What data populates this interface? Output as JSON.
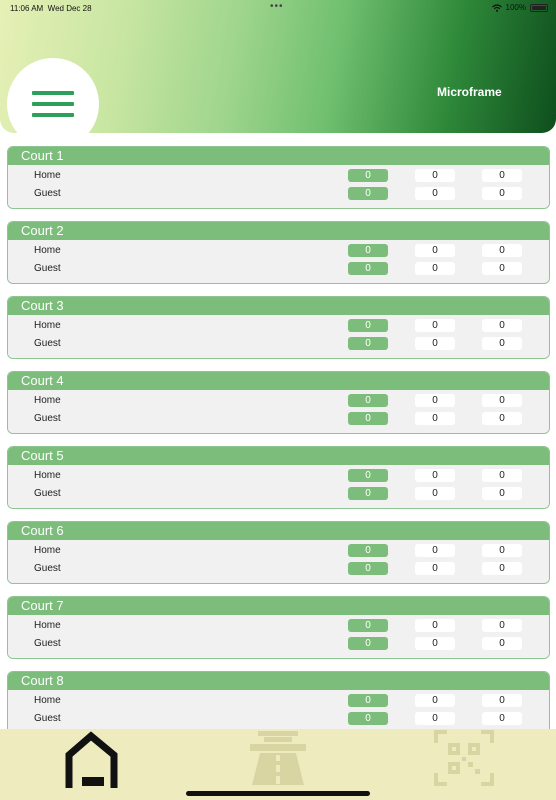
{
  "status": {
    "time": "11:06 AM",
    "date": "Wed Dec 28",
    "battery": "100%"
  },
  "header": {
    "title": "Microframe"
  },
  "courts": [
    {
      "name": "Court 1",
      "home_label": "Home",
      "guest_label": "Guest",
      "home": [
        "0",
        "0",
        "0"
      ],
      "guest": [
        "0",
        "0",
        "0"
      ]
    },
    {
      "name": "Court 2",
      "home_label": "Home",
      "guest_label": "Guest",
      "home": [
        "0",
        "0",
        "0"
      ],
      "guest": [
        "0",
        "0",
        "0"
      ]
    },
    {
      "name": "Court 3",
      "home_label": "Home",
      "guest_label": "Guest",
      "home": [
        "0",
        "0",
        "0"
      ],
      "guest": [
        "0",
        "0",
        "0"
      ]
    },
    {
      "name": "Court 4",
      "home_label": "Home",
      "guest_label": "Guest",
      "home": [
        "0",
        "0",
        "0"
      ],
      "guest": [
        "0",
        "0",
        "0"
      ]
    },
    {
      "name": "Court 5",
      "home_label": "Home",
      "guest_label": "Guest",
      "home": [
        "0",
        "0",
        "0"
      ],
      "guest": [
        "0",
        "0",
        "0"
      ]
    },
    {
      "name": "Court 6",
      "home_label": "Home",
      "guest_label": "Guest",
      "home": [
        "0",
        "0",
        "0"
      ],
      "guest": [
        "0",
        "0",
        "0"
      ]
    },
    {
      "name": "Court 7",
      "home_label": "Home",
      "guest_label": "Guest",
      "home": [
        "0",
        "0",
        "0"
      ],
      "guest": [
        "0",
        "0",
        "0"
      ]
    },
    {
      "name": "Court 8",
      "home_label": "Home",
      "guest_label": "Guest",
      "home": [
        "0",
        "0",
        "0"
      ],
      "guest": [
        "0",
        "0",
        "0"
      ]
    }
  ],
  "tabs": [
    {
      "icon": "home-icon",
      "active": true
    },
    {
      "icon": "road-icon",
      "active": false
    },
    {
      "icon": "qr-scan-icon",
      "active": false
    }
  ],
  "colors": {
    "accent": "#7dbd7b",
    "menu_icon": "#2e9f5c",
    "tab_bar": "#eeecbf",
    "header_dark": "#0e4e1d"
  }
}
